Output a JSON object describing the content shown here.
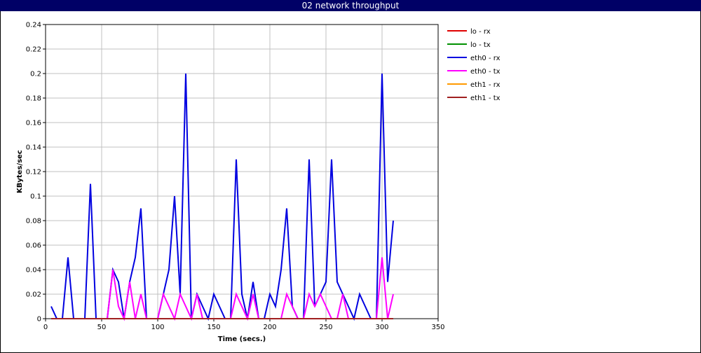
{
  "window": {
    "title": "02 network throughput"
  },
  "colors": {
    "titlebar_bg": "#000066",
    "grid": "#c0c0c0",
    "lo_rx": "#e00000",
    "lo_tx": "#009000",
    "eth0_rx": "#0000e0",
    "eth0_tx": "#ff00ff",
    "eth1_rx": "#ff9900",
    "eth1_tx": "#a02020"
  },
  "chart_data": {
    "type": "line",
    "title": "02 network throughput",
    "xlabel": "Time (secs.)",
    "ylabel": "KBytes/sec",
    "xlim": [
      0,
      350
    ],
    "ylim": [
      0,
      0.24
    ],
    "xticks": [
      0,
      50,
      100,
      150,
      200,
      250,
      300,
      350
    ],
    "yticks": [
      0,
      0.02,
      0.04,
      0.06,
      0.08,
      0.1,
      0.12,
      0.14,
      0.16,
      0.18,
      0.2,
      0.22,
      0.24
    ],
    "ytick_labels": [
      "0",
      "0.02",
      "0.04",
      "0.06",
      "0.08",
      "0.1",
      "0.12",
      "0.14",
      "0.16",
      "0.18",
      "0.2",
      "0.22",
      "0.24"
    ],
    "grid": true,
    "legend_position": "right",
    "x": [
      5,
      10,
      15,
      20,
      25,
      30,
      35,
      40,
      45,
      50,
      55,
      60,
      65,
      70,
      75,
      80,
      85,
      90,
      95,
      100,
      105,
      110,
      115,
      120,
      125,
      130,
      135,
      140,
      145,
      150,
      155,
      160,
      165,
      170,
      175,
      180,
      185,
      190,
      195,
      200,
      205,
      210,
      215,
      220,
      225,
      230,
      235,
      240,
      245,
      250,
      255,
      260,
      265,
      270,
      275,
      280,
      285,
      290,
      295,
      300,
      305,
      310
    ],
    "series": [
      {
        "name": "lo - rx",
        "color_key": "lo_rx",
        "values": [
          0,
          0,
          0,
          0,
          0,
          0,
          0,
          0,
          0,
          0,
          0,
          0,
          0,
          0,
          0,
          0,
          0,
          0,
          0,
          0,
          0,
          0,
          0,
          0,
          0,
          0,
          0,
          0,
          0,
          0,
          0,
          0,
          0,
          0,
          0,
          0,
          0,
          0,
          0,
          0,
          0,
          0,
          0,
          0,
          0,
          0,
          0,
          0,
          0,
          0,
          0,
          0,
          0,
          0,
          0,
          0,
          0,
          0,
          0,
          0,
          0,
          0
        ]
      },
      {
        "name": "lo - tx",
        "color_key": "lo_tx",
        "values": [
          0,
          0,
          0,
          0,
          0,
          0,
          0,
          0,
          0,
          0,
          0,
          0,
          0,
          0,
          0,
          0,
          0,
          0,
          0,
          0,
          0,
          0,
          0,
          0,
          0,
          0,
          0,
          0,
          0,
          0,
          0,
          0,
          0,
          0,
          0,
          0,
          0,
          0,
          0,
          0,
          0,
          0,
          0,
          0,
          0,
          0,
          0,
          0,
          0,
          0,
          0,
          0,
          0,
          0,
          0,
          0,
          0,
          0,
          0,
          0,
          0,
          0
        ]
      },
      {
        "name": "eth0 - rx",
        "color_key": "eth0_rx",
        "values": [
          0.01,
          0,
          0,
          0.05,
          0,
          0,
          0,
          0.11,
          0,
          0,
          0,
          0.04,
          0.03,
          0,
          0.03,
          0.05,
          0.09,
          0,
          0,
          0,
          0.02,
          0.04,
          0.1,
          0.02,
          0.2,
          0,
          0.02,
          0.01,
          0,
          0.02,
          0.01,
          0,
          0,
          0.13,
          0.02,
          0,
          0.03,
          0,
          0,
          0.02,
          0.01,
          0.04,
          0.09,
          0.01,
          0,
          0,
          0.13,
          0.01,
          0.02,
          0.03,
          0.13,
          0.03,
          0.02,
          0.01,
          0,
          0.02,
          0.01,
          0,
          0,
          0.2,
          0.03,
          0.08
        ]
      },
      {
        "name": "eth0 - tx",
        "color_key": "eth0_tx",
        "values": [
          0,
          0,
          0,
          0,
          0,
          0,
          0,
          0,
          0,
          0,
          0,
          0.04,
          0.01,
          0,
          0.03,
          0,
          0.02,
          0,
          0,
          0,
          0.02,
          0.01,
          0,
          0.02,
          0.01,
          0,
          0.02,
          0,
          0,
          0,
          0,
          0,
          0,
          0.02,
          0.01,
          0,
          0.02,
          0,
          0,
          0,
          0,
          0,
          0.02,
          0.01,
          0,
          0,
          0.02,
          0.01,
          0.02,
          0.01,
          0,
          0,
          0.02,
          0,
          0,
          0,
          0,
          0,
          0,
          0.05,
          0,
          0.02
        ]
      },
      {
        "name": "eth1 - rx",
        "color_key": "eth1_rx",
        "values": [
          0,
          0,
          0,
          0,
          0,
          0,
          0,
          0,
          0,
          0,
          0,
          0,
          0,
          0,
          0,
          0,
          0,
          0,
          0,
          0,
          0,
          0,
          0,
          0,
          0,
          0,
          0,
          0,
          0,
          0,
          0,
          0,
          0,
          0,
          0,
          0,
          0,
          0,
          0,
          0,
          0,
          0,
          0,
          0,
          0,
          0,
          0,
          0,
          0,
          0,
          0,
          0,
          0,
          0,
          0,
          0,
          0,
          0,
          0,
          0,
          0,
          0
        ]
      },
      {
        "name": "eth1 - tx",
        "color_key": "eth1_tx",
        "values": [
          0,
          0,
          0,
          0,
          0,
          0,
          0,
          0,
          0,
          0,
          0,
          0,
          0,
          0,
          0,
          0,
          0,
          0,
          0,
          0,
          0,
          0,
          0,
          0,
          0,
          0,
          0,
          0,
          0,
          0,
          0,
          0,
          0,
          0,
          0,
          0,
          0,
          0,
          0,
          0,
          0,
          0,
          0,
          0,
          0,
          0,
          0,
          0,
          0,
          0,
          0,
          0,
          0,
          0,
          0,
          0,
          0,
          0,
          0,
          0,
          0,
          0
        ]
      }
    ]
  }
}
